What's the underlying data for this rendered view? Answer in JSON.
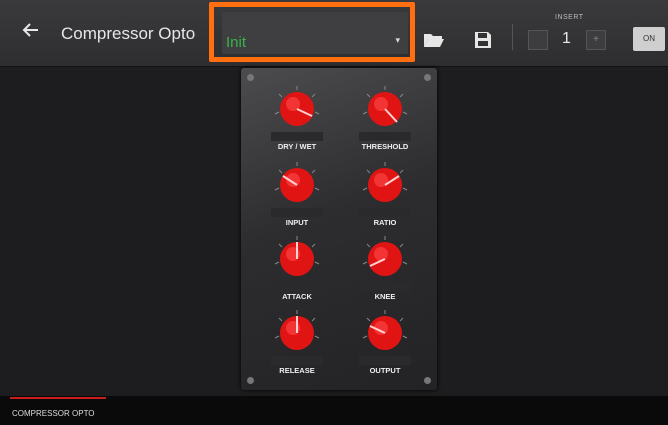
{
  "header": {
    "back_icon": "arrow-left-icon",
    "title": "Compressor Opto",
    "preset_value": "Init",
    "preset_caret": "▾",
    "folder_icon": "folder-open-icon",
    "save_icon": "save-icon",
    "insert_label": "INSERT",
    "insert_number": "1",
    "insert_next": "+",
    "on_label": "ON"
  },
  "colors": {
    "highlight": "#ff6f0f",
    "knob": "#e11414",
    "preset_text": "#3ab34a",
    "tab_indicator": "#c91c1c"
  },
  "knobs": [
    {
      "label": "DRY / WET"
    },
    {
      "label": "THRESHOLD"
    },
    {
      "label": "INPUT"
    },
    {
      "label": "RATIO"
    },
    {
      "label": "ATTACK"
    },
    {
      "label": "KNEE"
    },
    {
      "label": "RELEASE"
    },
    {
      "label": "OUTPUT"
    }
  ],
  "footer": {
    "tab_label": "COMPRESSOR OPTO"
  }
}
